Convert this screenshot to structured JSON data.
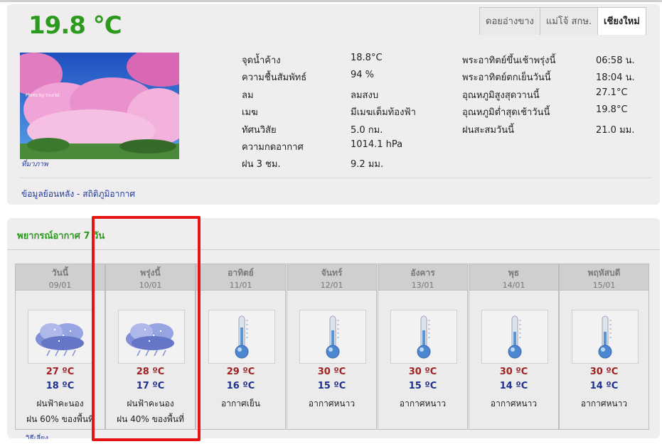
{
  "current": {
    "temperature": "19.8 °C",
    "stations": [
      "ดอยอ่างขาง",
      "แม่โจ้ สกษ.",
      "เชียงใหม่"
    ],
    "active_station": "เชียงใหม่",
    "photo_caption": "ที่มาภาพ",
    "photo_watermark": "Photo by tourist",
    "observations_left": [
      {
        "label": "จุดน้ำค้าง",
        "value": "18.8°C"
      },
      {
        "label": "ความชื้นสัมพัทธ์",
        "value": "94 %"
      },
      {
        "label": "ลม",
        "value": "ลมสงบ"
      },
      {
        "label": "เมฆ",
        "value": "มีเมฆเต็มท้องฟ้า"
      },
      {
        "label": "ทัศนวิสัย",
        "value": "5.0 กม."
      },
      {
        "label": "ความกดอากาศ",
        "value": "1014.1 hPa"
      },
      {
        "label": "ฝน 3 ชม.",
        "value": "9.2 มม."
      }
    ],
    "observations_right": [
      {
        "label": "พระอาทิตย์ขึ้นเช้าพรุ่งนี้",
        "value": "06:58 น."
      },
      {
        "label": "พระอาทิตย์ตกเย็นวันนี้",
        "value": "18:04 น."
      },
      {
        "label": "อุณหภูมิสูงสุดวานนี้",
        "value": "27.1°C"
      },
      {
        "label": "อุณหภูมิต่ำสุดเช้าวันนี้",
        "value": "19.8°C"
      },
      {
        "label": "ฝนสะสมวันนี้",
        "value": "21.0 มม."
      }
    ],
    "history_link": "ข้อมูลย้อนหลัง - สถิติภูมิอากาศ"
  },
  "forecast": {
    "title": "พยากรณ์อากาศ 7 วัน",
    "days": [
      {
        "name": "วันนี้",
        "date": "09/01",
        "icon": "storm-cloud-icon",
        "high": "27 ºC",
        "low": "18 ºC",
        "condition": "ฝนฟ้าคะนอง",
        "rain": "ฝน 60% ของพื้นที่"
      },
      {
        "name": "พรุ่งนี้",
        "date": "10/01",
        "icon": "storm-cloud-icon",
        "high": "28 ºC",
        "low": "17 ºC",
        "condition": "ฝนฟ้าคะนอง",
        "rain": "ฝน 40% ของพื้นที่"
      },
      {
        "name": "อาทิตย์",
        "date": "11/01",
        "icon": "thermometer-icon",
        "high": "29 ºC",
        "low": "16 ºC",
        "condition": "อากาศเย็น",
        "rain": ""
      },
      {
        "name": "จันทร์",
        "date": "12/01",
        "icon": "thermometer-icon",
        "high": "30 ºC",
        "low": "15 ºC",
        "condition": "อากาศหนาว",
        "rain": ""
      },
      {
        "name": "อังคาร",
        "date": "13/01",
        "icon": "thermometer-icon",
        "high": "30 ºC",
        "low": "15 ºC",
        "condition": "อากาศหนาว",
        "rain": ""
      },
      {
        "name": "พุธ",
        "date": "14/01",
        "icon": "thermometer-icon",
        "high": "30 ºC",
        "low": "14 ºC",
        "condition": "อากาศหนาว",
        "rain": ""
      },
      {
        "name": "พฤหัสบดี",
        "date": "15/01",
        "icon": "thermometer-icon",
        "high": "30 ºC",
        "low": "14 ºC",
        "condition": "อากาศหนาว",
        "rain": ""
      }
    ],
    "bottom_link": "วิธีเลี่ยง"
  },
  "colors": {
    "current_temp": "#2c9a1f",
    "high_temp": "#a02020",
    "low_temp": "#1f2f8f",
    "highlight": "#e81414",
    "link": "#1d3b9e"
  }
}
